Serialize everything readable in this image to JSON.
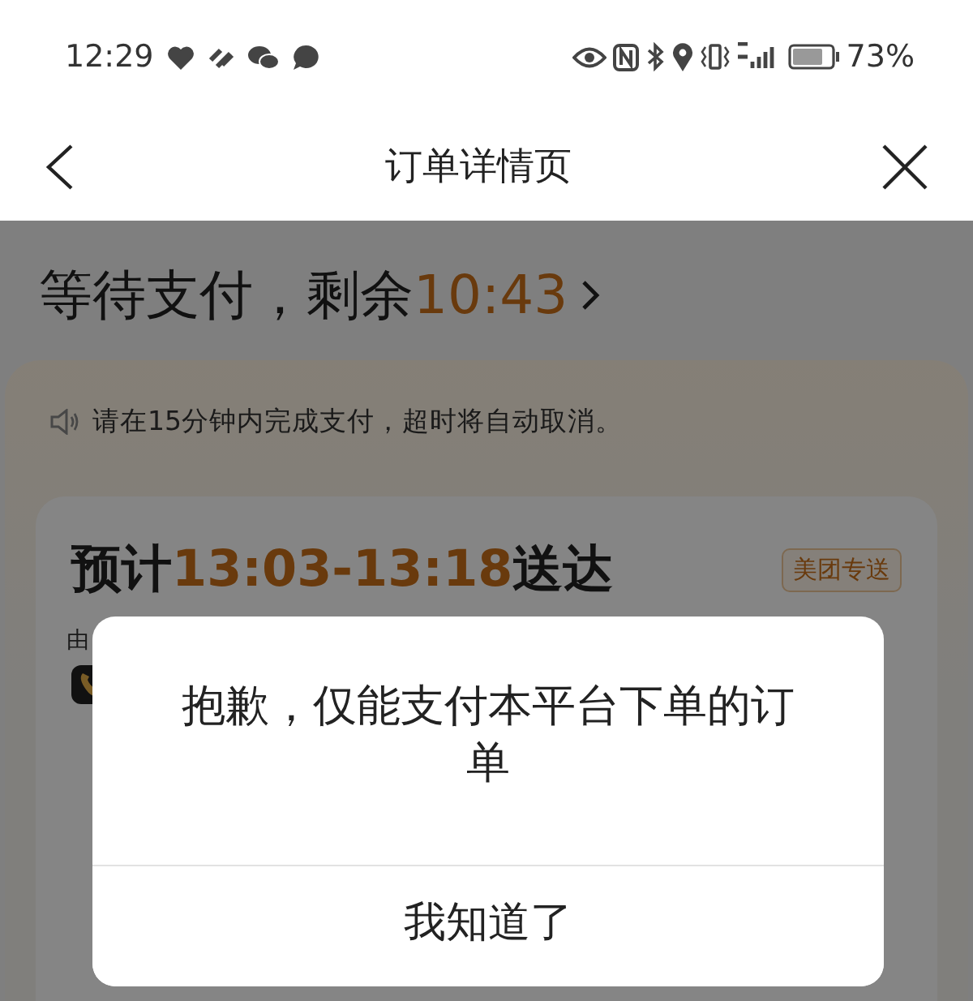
{
  "status_bar": {
    "time": "12:29",
    "battery": "73%"
  },
  "header": {
    "title": "订单详情页"
  },
  "payment": {
    "title": "等待支付，剩余",
    "countdown": "10:43",
    "notice": "请在15分钟内完成支付，超时将自动取消。"
  },
  "delivery": {
    "prefix": "预计",
    "time": "13:03-13:18",
    "suffix": "送达",
    "tag": "美团专送",
    "rider_line": "由"
  },
  "dialog": {
    "message": "抱歉，仅能支付本平台下单的订单",
    "button": "我知道了"
  }
}
